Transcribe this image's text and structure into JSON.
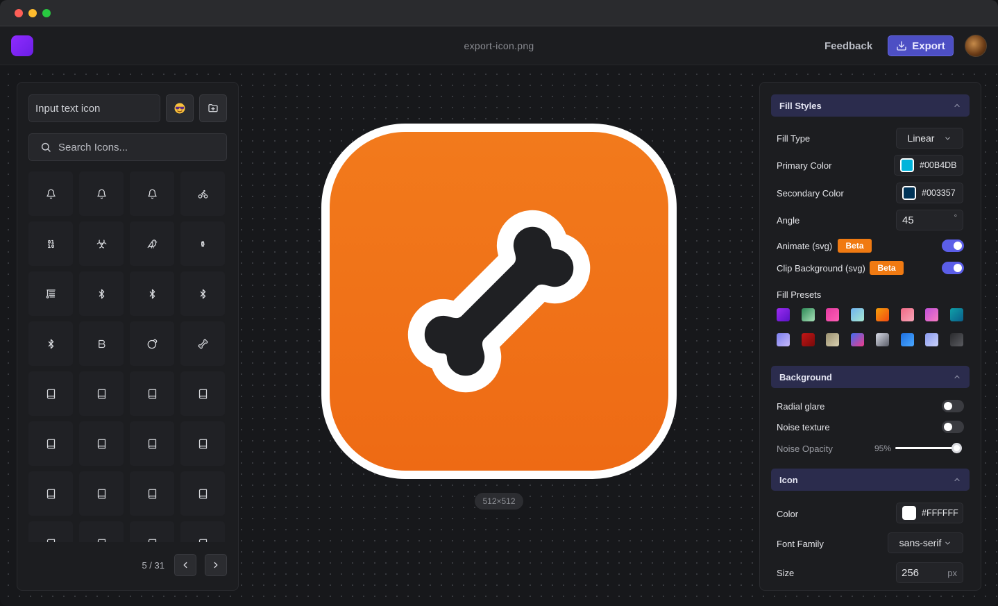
{
  "app": {
    "filename": "export-icon.png",
    "feedback_label": "Feedback",
    "export_label": "Export",
    "size_label": "512×512",
    "accent": "#4d4fc4"
  },
  "left_panel": {
    "text_input_placeholder": "Input text icon",
    "emoji_button_icon": "smiling-face-sunglasses-icon",
    "folder_button_icon": "folder-open-icon",
    "search_placeholder": "Search Icons...",
    "page_label": "5 / 31",
    "icons": [
      "bell-plus-icon",
      "bell-ring-icon",
      "bell-icon",
      "bike-icon",
      "binary-icon",
      "biohazard-icon",
      "bird-icon",
      "bitcoin-icon",
      "blinds-icon",
      "bluetooth-connected-icon",
      "bluetooth-off-icon",
      "bluetooth-searching-icon",
      "bluetooth-icon",
      "bold-icon",
      "bomb-icon",
      "bone-icon",
      "book-copy-icon",
      "book-down-icon",
      "book-key-icon",
      "book-lock-icon",
      "book-marked-icon",
      "book-minus-icon",
      "book-open-check-icon",
      "book-open-icon",
      "book-plus-icon",
      "book-dashed-icon",
      "book-up-icon",
      "book-up-2-icon",
      "book-x-icon",
      "book-icon",
      "book-text-icon",
      "book-user-icon"
    ]
  },
  "preview": {
    "bg_color": "#f07418",
    "border_color": "#ffffff",
    "icon_name": "bone-icon",
    "icon_stroke": "#ffffff"
  },
  "fill_styles": {
    "header": "Fill Styles",
    "fill_type_label": "Fill Type",
    "fill_type_value": "Linear",
    "primary_color_label": "Primary Color",
    "primary_color_value": "#00B4DB",
    "primary_color_hex": "#00B4DB",
    "secondary_color_label": "Secondary Color",
    "secondary_color_value": "#003357",
    "secondary_color_hex": "#003357",
    "angle_label": "Angle",
    "angle_value": "45",
    "angle_unit": "°",
    "animate_label": "Animate (svg)",
    "animate_badge": "Beta",
    "animate_on": true,
    "clip_label": "Clip Background (svg)",
    "clip_badge": "Beta",
    "clip_on": true,
    "presets_label": "Fill Presets"
  },
  "background": {
    "header": "Background",
    "radial_glare_label": "Radial glare",
    "radial_glare_on": false,
    "noise_texture_label": "Noise texture",
    "noise_texture_on": false,
    "noise_opacity_label": "Noise Opacity",
    "noise_opacity_value": "95%",
    "noise_opacity_fraction": 0.95
  },
  "icon_section": {
    "header": "Icon",
    "color_label": "Color",
    "color_value": "#FFFFFF",
    "color_hex": "#FFFFFF",
    "font_family_label": "Font Family",
    "font_family_value": "sans-serif",
    "size_label": "Size",
    "size_value": "256",
    "size_unit": "px"
  }
}
